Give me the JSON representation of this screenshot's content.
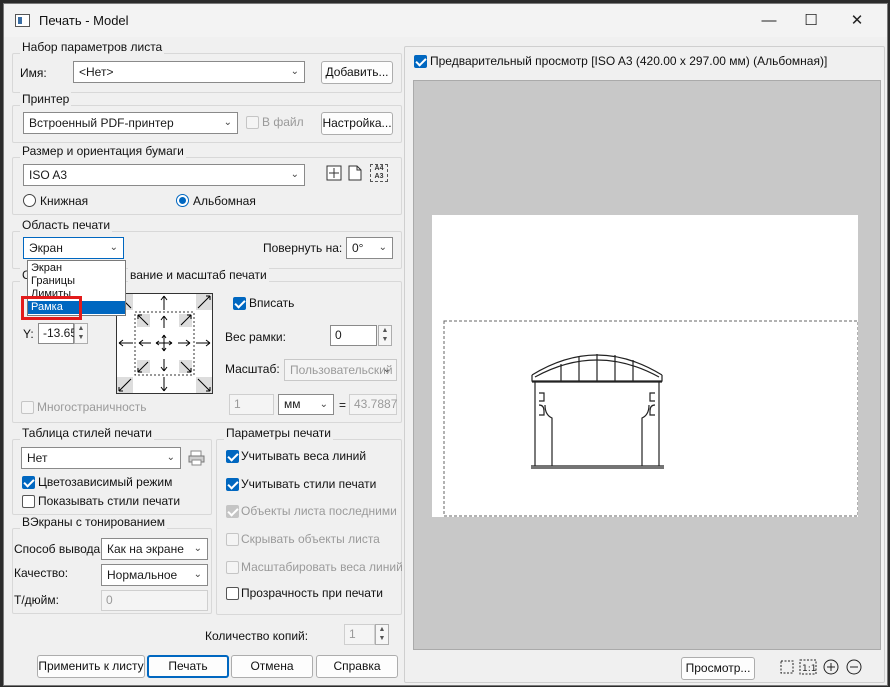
{
  "window": {
    "title": "Печать - Model",
    "minimize": "—",
    "maximize": "☐",
    "close": "✕"
  },
  "page_setup": {
    "group_label": "Набор параметров листа",
    "name_label": "Имя:",
    "name_value": "<Нет>",
    "add_button": "Добавить..."
  },
  "printer": {
    "group_label": "Принтер",
    "device_value": "Встроенный PDF-принтер",
    "to_file_label": "В файл",
    "setup_button": "Настройка..."
  },
  "paper": {
    "group_label": "Размер и ориентация бумаги",
    "size_value": "ISO A3",
    "portrait_label": "Книжная",
    "landscape_label": "Альбомная",
    "selected": "landscape",
    "icon_a4_a3": "A4 A3"
  },
  "plot_area": {
    "group_label": "Область печати",
    "what_value": "Экран",
    "options": [
      "Экран",
      "Границы",
      "Лимиты",
      "Рамка"
    ],
    "highlighted_option": "Рамка",
    "rotate_label": "Повернуть на:",
    "rotate_value": "0°"
  },
  "offset_scale": {
    "group_label_partial": "вание и масштаб печати",
    "group_prefix": "С",
    "y_label": "Y:",
    "y_value": "-13.65",
    "fit_label": "Вписать",
    "fit_checked": true,
    "frame_weight_label": "Вес рамки:",
    "frame_weight_value": "0",
    "scale_label": "Масштаб:",
    "scale_value": "Пользовательский",
    "ratio_left": "1",
    "unit_value": "мм",
    "ratio_right": "43.7887",
    "equals": "=",
    "multipage_label": "Многостраничность"
  },
  "plot_style_table": {
    "group_label": "Таблица стилей печати",
    "value": "Нет",
    "color_dependent_label": "Цветозависимый режим",
    "color_dependent_checked": true,
    "show_styles_label": "Показывать стили печати",
    "show_styles_checked": false
  },
  "shaded_viewports": {
    "group_label": "ВЭкраны с тонированием",
    "output_label": "Способ вывода:",
    "output_value": "Как на экране",
    "quality_label": "Качество:",
    "quality_value": "Нормальное",
    "dpi_label": "Т/дюйм:",
    "dpi_value": "0"
  },
  "plot_options": {
    "group_label": "Параметры печати",
    "items": [
      {
        "label": "Учитывать веса линий",
        "checked": true,
        "disabled": false
      },
      {
        "label": "Учитывать стили печати",
        "checked": true,
        "disabled": false
      },
      {
        "label": "Объекты листа последними",
        "checked": true,
        "disabled": true
      },
      {
        "label": "Скрывать объекты листа",
        "checked": false,
        "disabled": true
      },
      {
        "label": "Масштабировать веса линий",
        "checked": false,
        "disabled": true
      },
      {
        "label": "Прозрачность при печати",
        "checked": false,
        "disabled": false
      }
    ]
  },
  "copies": {
    "label": "Количество копий:",
    "value": "1"
  },
  "footer": {
    "apply_button": "Применить к листу",
    "ok_button": "Печать",
    "cancel_button": "Отмена",
    "help_button": "Справка",
    "preview_button": "Просмотр..."
  },
  "preview": {
    "checkbox_label": "Предварительный просмотр [ISO A3 (420.00 x 297.00 мм) (Альбомная)]",
    "checked": true
  },
  "colors": {
    "accent": "#0067c0",
    "highlight_box": "#e21b1b",
    "preview_bg": "#c8c8c8"
  }
}
